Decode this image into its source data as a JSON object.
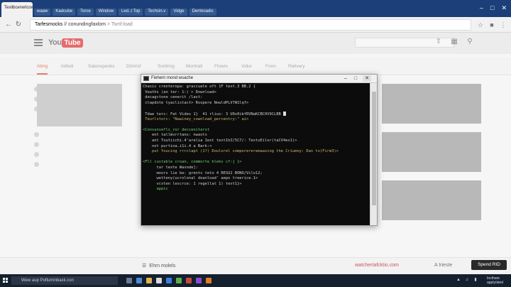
{
  "browser": {
    "active_tab": "Texilbcerwrlcowcribfe",
    "tabs": [
      "waaw",
      "Kadcube",
      "Torce",
      "Window",
      "Led..t Top",
      "Techcin.v",
      "Vidge",
      "Demkoadis"
    ],
    "url_host": "Tarfesmocks",
    "url_sep": " // ",
    "url_mid": "conundingfaxlom",
    "url_path": " > Tsmf:load"
  },
  "youtube": {
    "logo_you": "You",
    "logo_tube": "Tube",
    "categories": [
      "Atmg",
      "Inifedi",
      "Satonspenks",
      "Drinrisf",
      "Sorilring",
      "Montrall",
      "Flowrs",
      "Vidur",
      "Fonn",
      "Relivery"
    ],
    "player": {
      "playlist_label": "Ehrn molels",
      "channel_link": "watchertafcktio.com",
      "auto_label": "A Irieste",
      "spend_button": "Spend RID"
    }
  },
  "terminal": {
    "title": "Fiehern mond wsache",
    "lines": [
      {
        "text": "Chasic crenteropa: graccuate oft 1F text.3 BB.2 {",
        "color": "white"
      },
      {
        "text": " Veaths (an ter: 1:) > Download>",
        "color": "white"
      },
      {
        "text": " decagctone cenerit /last:",
        "color": "white"
      },
      {
        "text": " ctapdote tyaclistact> Rospere NowldPLV7W1lqf>",
        "color": "white"
      },
      {
        "text": "",
        "color": "white"
      },
      {
        "text": " Tdae terc: Fat Vides 1}  41 rlius: 3 U0x0ibfRVNaKCBC0V9CLBB",
        "color": "white"
      },
      {
        "text": " Teurlstorc: \"Nawiney_cownload_percentry:\" ai>",
        "color": "yellow"
      },
      {
        "text": "",
        "color": "white"
      },
      {
        "text": "<Consunsefls_ror deccenitarst",
        "color": "green"
      },
      {
        "text": "    ent tallmvrrtans: nwasts",
        "color": "white"
      },
      {
        "text": "    ant Toutiichi.4'arelia Iext text1hZ/5C7/: TextuEilor(taCV4ex1)>",
        "color": "white"
      },
      {
        "text": "    not purtina.i1i.4 a Bark:<",
        "color": "white"
      },
      {
        "text": "    put Youcing rrrclapt (1?) Doulorel comporereremaaxing the Criumny: Dan to(Firm3)>",
        "color": "yellow"
      },
      {
        "text": "",
        "color": "white"
      },
      {
        "text": "<Fll custable croan, commorte bleks cf:j }>",
        "color": "green"
      },
      {
        "text": "      tar texte Wasnde]:",
        "color": "white"
      },
      {
        "text": "      moors lie be: grents teto 4 RESU2 BONO/Vilo12;",
        "color": "white"
      },
      {
        "text": "      wetteny(ucrolonal doanload' aepo treerice.1>",
        "color": "white"
      },
      {
        "text": "      vcsten lescrce: 1 regellat 1) text1}>",
        "color": "white"
      },
      {
        "text": "      appic",
        "color": "green"
      }
    ]
  },
  "taskbar": {
    "search_placeholder": "Wew aup Pofluminbaxk.con",
    "tray_line1": "Incthare",
    "tray_line2": "apply/ated"
  },
  "colors": {
    "chrome_tabbar": "#1c3f79",
    "terminal_bg": "#0c0c0c",
    "accent": "#e0826f",
    "taskbar": "#15202f"
  }
}
